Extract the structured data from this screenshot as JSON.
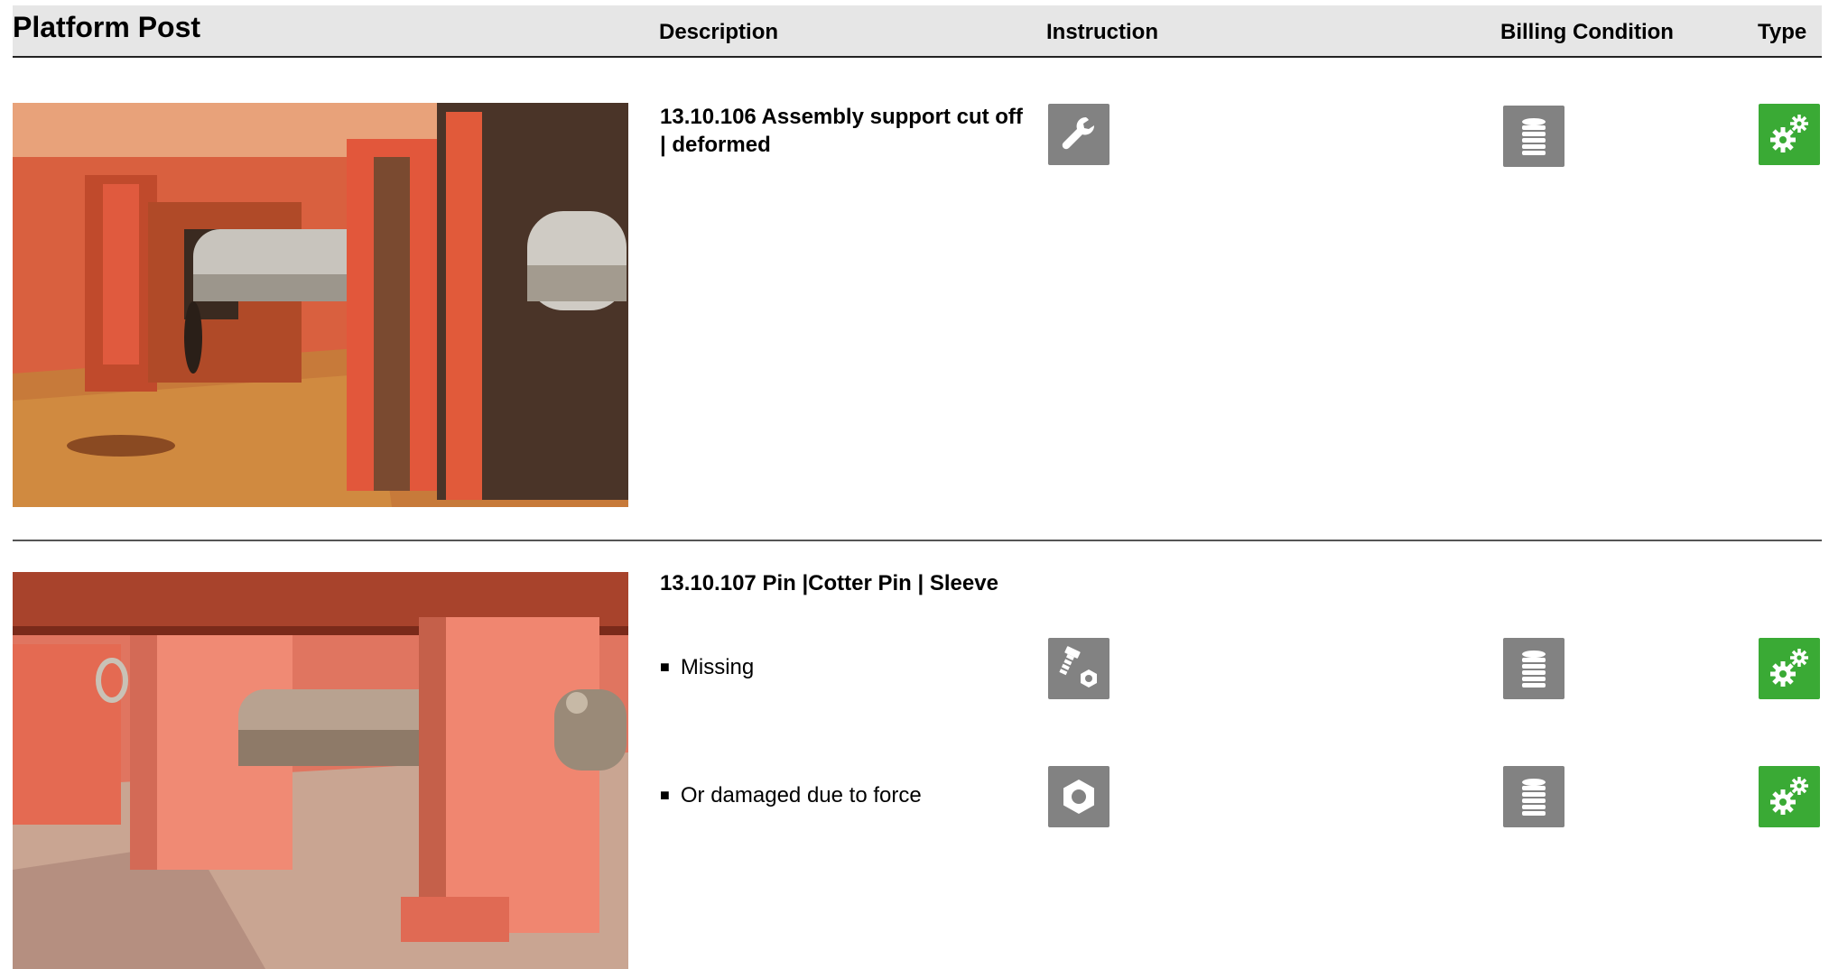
{
  "header": {
    "title": "Platform Post",
    "description": "Description",
    "instruction": "Instruction",
    "billing_condition": "Billing Condition",
    "type": "Type"
  },
  "entries": [
    {
      "title_line1": "13.10.106 Assembly support cut off",
      "title_line2": "| deformed",
      "instruction_icon": "wrench-icon",
      "billing_icon": "coin-stack-icon",
      "type_icon": "gears-icon"
    },
    {
      "title": "13.10.107 Pin |Cotter Pin | Sleeve",
      "items": [
        {
          "text": "Missing",
          "instruction_icon": "bolt-nut-icon",
          "billing_icon": "coin-stack-icon",
          "type_icon": "gears-icon"
        },
        {
          "text": "Or damaged due to force",
          "instruction_icon": "nut-icon",
          "billing_icon": "coin-stack-icon",
          "type_icon": "gears-icon"
        }
      ]
    }
  ],
  "colors": {
    "header_bg": "#e6e6e6",
    "icon_gray": "#828282",
    "icon_green": "#3aaa35"
  }
}
